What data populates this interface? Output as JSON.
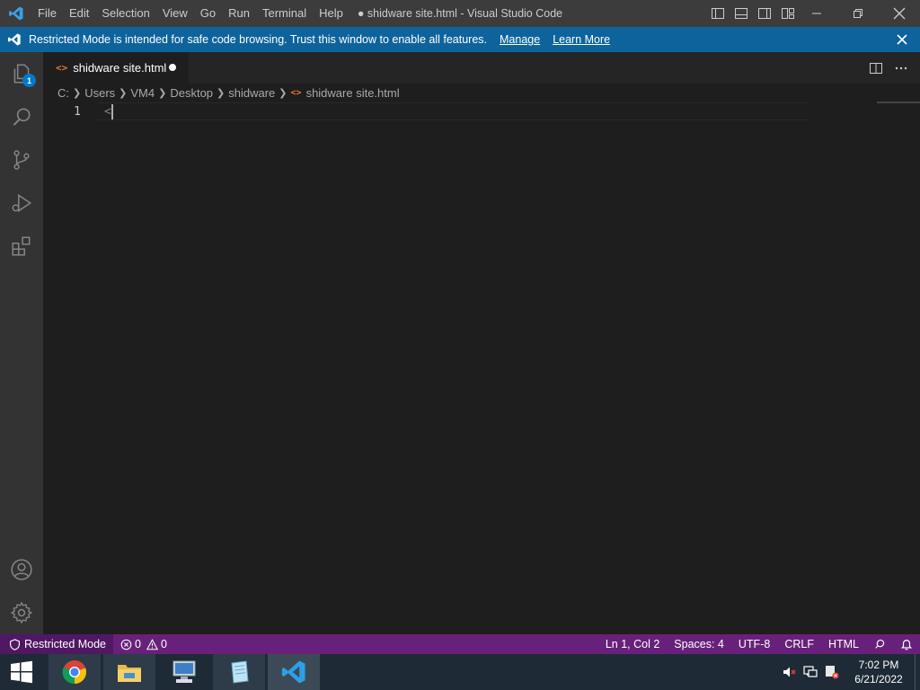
{
  "titlebar": {
    "menu": [
      "File",
      "Edit",
      "Selection",
      "View",
      "Go",
      "Run",
      "Terminal",
      "Help"
    ],
    "window_title": "● shidware site.html - Visual Studio Code"
  },
  "banner": {
    "message": "Restricted Mode is intended for safe code browsing. Trust this window to enable all features.",
    "manage": "Manage",
    "learn_more": "Learn More"
  },
  "activitybar": {
    "explorer_badge": "1",
    "items": [
      "explorer-icon",
      "search-icon",
      "source-control-icon",
      "run-debug-icon",
      "extensions-icon",
      "accounts-icon",
      "settings-gear-icon"
    ]
  },
  "tab": {
    "file_icon": "<>",
    "label": "shidware site.html"
  },
  "breadcrumb": {
    "parts": [
      "C:",
      "Users",
      "VM4",
      "Desktop",
      "shidware"
    ],
    "file_icon": "<>",
    "file": "shidware site.html"
  },
  "editor": {
    "line_number": "1",
    "line_text": "<"
  },
  "statusbar": {
    "restricted": "Restricted Mode",
    "errors": "0",
    "warnings": "0",
    "position": "Ln 1, Col 2",
    "spaces": "Spaces: 4",
    "encoding": "UTF-8",
    "eol": "CRLF",
    "language": "HTML",
    "color": "#68217a"
  },
  "taskbar": {
    "time": "7:02 PM",
    "date": "6/21/2022"
  },
  "colors": {
    "accent": "#007acc",
    "banner": "#0e639c",
    "statusbar": "#68217a",
    "file_icon": "#e37933"
  }
}
